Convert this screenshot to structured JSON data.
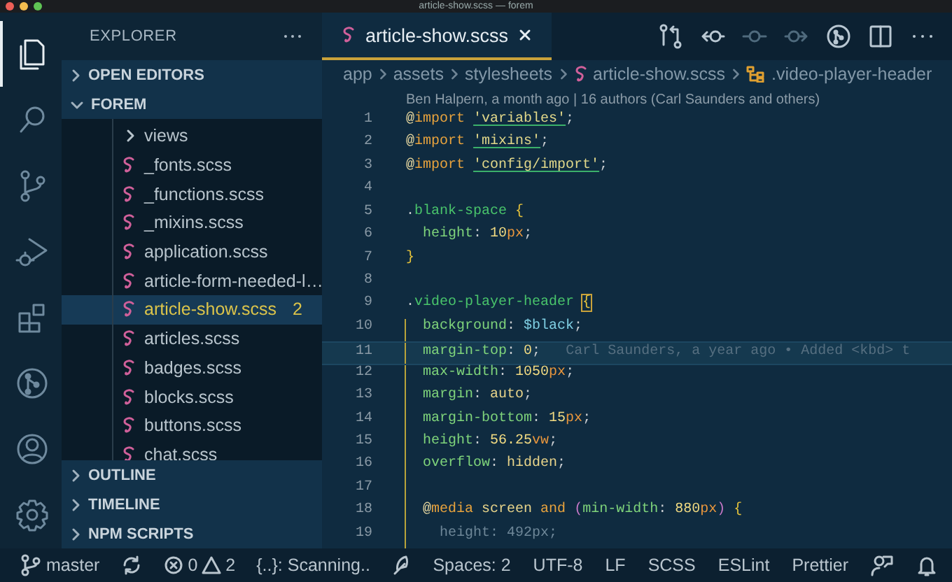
{
  "window": {
    "title": "article-show.scss — forem"
  },
  "activity_bar": [
    {
      "kind": "files",
      "selected": true
    },
    {
      "kind": "search",
      "selected": false
    },
    {
      "kind": "source-control",
      "selected": false
    },
    {
      "kind": "run",
      "selected": false
    },
    {
      "kind": "extensions",
      "selected": false
    },
    {
      "kind": "graph",
      "selected": false
    },
    {
      "kind": "account",
      "selected": false
    },
    {
      "kind": "settings",
      "selected": false
    }
  ],
  "sidebar": {
    "title": "EXPLORER",
    "sections": [
      {
        "label": "OPEN EDITORS",
        "expanded": false
      },
      {
        "label": "FOREM",
        "expanded": true,
        "items": [
          {
            "label": "views",
            "kind": "folder",
            "selected": false
          },
          {
            "label": "_fonts.scss",
            "kind": "scss",
            "selected": false
          },
          {
            "label": "_functions.scss",
            "kind": "scss",
            "selected": false
          },
          {
            "label": "_mixins.scss",
            "kind": "scss",
            "selected": false
          },
          {
            "label": "application.scss",
            "kind": "scss",
            "selected": false
          },
          {
            "label": "article-form-needed-l…",
            "kind": "scss",
            "selected": false
          },
          {
            "label": "article-show.scss",
            "kind": "scss",
            "selected": true,
            "badge": "2"
          },
          {
            "label": "articles.scss",
            "kind": "scss",
            "selected": false
          },
          {
            "label": "badges.scss",
            "kind": "scss",
            "selected": false
          },
          {
            "label": "blocks.scss",
            "kind": "scss",
            "selected": false
          },
          {
            "label": "buttons.scss",
            "kind": "scss",
            "selected": false
          },
          {
            "label": "chat.scss",
            "kind": "scss",
            "selected": false
          }
        ]
      },
      {
        "label": "OUTLINE",
        "expanded": false
      },
      {
        "label": "TIMELINE",
        "expanded": false
      },
      {
        "label": "NPM SCRIPTS",
        "expanded": false
      }
    ]
  },
  "editor": {
    "tabs": [
      {
        "label": "article-show.scss",
        "selected": true
      }
    ],
    "actions": [
      {
        "kind": "compare",
        "disabled": false
      },
      {
        "kind": "prev",
        "disabled": false
      },
      {
        "kind": "dot",
        "disabled": true
      },
      {
        "kind": "next",
        "disabled": true
      },
      {
        "kind": "graph",
        "disabled": false
      },
      {
        "kind": "split",
        "disabled": false
      },
      {
        "kind": "more",
        "disabled": false
      }
    ],
    "breadcrumbs": [
      {
        "label": "app",
        "kind": "folder"
      },
      {
        "label": "assets",
        "kind": "folder"
      },
      {
        "label": "stylesheets",
        "kind": "folder"
      },
      {
        "label": "article-show.scss",
        "kind": "file"
      },
      {
        "label": ".video-player-header",
        "kind": "symbol"
      }
    ],
    "blame_header": "Ben Halpern, a month ago | 16 authors (Carl Saunders and others)",
    "lines": [
      {
        "number": "1",
        "tokens": [
          {
            "text": "@",
            "kind": "at"
          },
          {
            "text": "import ",
            "kind": "kw"
          },
          {
            "text": "'variables'",
            "kind": "str"
          },
          {
            "text": ";",
            "kind": "p"
          }
        ]
      },
      {
        "number": "2",
        "tokens": [
          {
            "text": "@",
            "kind": "at"
          },
          {
            "text": "import ",
            "kind": "kw"
          },
          {
            "text": "'mixins'",
            "kind": "str"
          },
          {
            "text": ";",
            "kind": "p"
          }
        ]
      },
      {
        "number": "3",
        "tokens": [
          {
            "text": "@",
            "kind": "at"
          },
          {
            "text": "import ",
            "kind": "kw"
          },
          {
            "text": "'config/import'",
            "kind": "str"
          },
          {
            "text": ";",
            "kind": "p"
          }
        ]
      },
      {
        "number": "4"
      },
      {
        "number": "5",
        "tokens": [
          {
            "text": ".",
            "kind": "p"
          },
          {
            "text": "blank-space ",
            "kind": "sel"
          },
          {
            "text": "{",
            "kind": "brace"
          }
        ]
      },
      {
        "number": "6",
        "tokens": [
          {
            "text": "  height",
            "kind": "prop"
          },
          {
            "text": ": ",
            "kind": "p"
          },
          {
            "text": "10",
            "kind": "num"
          },
          {
            "text": "px",
            "kind": "unit"
          },
          {
            "text": ";",
            "kind": "p"
          }
        ]
      },
      {
        "number": "7",
        "tokens": [
          {
            "text": "}",
            "kind": "brace"
          }
        ]
      },
      {
        "number": "8"
      },
      {
        "number": "9",
        "tokens": [
          {
            "text": ".",
            "kind": "p"
          },
          {
            "text": "video-player-header ",
            "kind": "sel"
          },
          {
            "text": "{",
            "kind": "match"
          }
        ]
      },
      {
        "number": "10",
        "in_block": true,
        "tokens": [
          {
            "text": "  background",
            "kind": "prop"
          },
          {
            "text": ": ",
            "kind": "p"
          },
          {
            "text": "$black",
            "kind": "var"
          },
          {
            "text": ";",
            "kind": "p"
          }
        ]
      },
      {
        "number": "11",
        "in_block": true,
        "current": true,
        "blame": "Carl Saunders, a year ago • Added <kbd> t",
        "tokens": [
          {
            "text": "  margin-top",
            "kind": "prop"
          },
          {
            "text": ": ",
            "kind": "p"
          },
          {
            "text": "0",
            "kind": "num"
          },
          {
            "text": ";",
            "kind": "p"
          }
        ]
      },
      {
        "number": "12",
        "in_block": true,
        "tokens": [
          {
            "text": "  max-width",
            "kind": "prop"
          },
          {
            "text": ": ",
            "kind": "p"
          },
          {
            "text": "1050",
            "kind": "num"
          },
          {
            "text": "px",
            "kind": "unit"
          },
          {
            "text": ";",
            "kind": "p"
          }
        ]
      },
      {
        "number": "13",
        "in_block": true,
        "tokens": [
          {
            "text": "  margin",
            "kind": "prop"
          },
          {
            "text": ": ",
            "kind": "p"
          },
          {
            "text": "auto",
            "kind": "val"
          },
          {
            "text": ";",
            "kind": "p"
          }
        ]
      },
      {
        "number": "14",
        "in_block": true,
        "tokens": [
          {
            "text": "  margin-bottom",
            "kind": "prop"
          },
          {
            "text": ": ",
            "kind": "p"
          },
          {
            "text": "15",
            "kind": "num"
          },
          {
            "text": "px",
            "kind": "unit"
          },
          {
            "text": ";",
            "kind": "p"
          }
        ]
      },
      {
        "number": "15",
        "in_block": true,
        "tokens": [
          {
            "text": "  height",
            "kind": "prop"
          },
          {
            "text": ": ",
            "kind": "p"
          },
          {
            "text": "56.25",
            "kind": "num"
          },
          {
            "text": "vw",
            "kind": "unit"
          },
          {
            "text": ";",
            "kind": "p"
          }
        ]
      },
      {
        "number": "16",
        "in_block": true,
        "tokens": [
          {
            "text": "  overflow",
            "kind": "prop"
          },
          {
            "text": ": ",
            "kind": "p"
          },
          {
            "text": "hidden",
            "kind": "val"
          },
          {
            "text": ";",
            "kind": "p"
          }
        ]
      },
      {
        "number": "17",
        "in_block": true
      },
      {
        "number": "18",
        "in_block": true,
        "tokens": [
          {
            "text": "  @",
            "kind": "at"
          },
          {
            "text": "media",
            "kind": "kw"
          },
          {
            "text": " screen ",
            "kind": "val"
          },
          {
            "text": "and ",
            "kind": "kw"
          },
          {
            "text": "(",
            "kind": "paren"
          },
          {
            "text": "min-width",
            "kind": "prop"
          },
          {
            "text": ": ",
            "kind": "p"
          },
          {
            "text": "880",
            "kind": "num"
          },
          {
            "text": "px",
            "kind": "unit"
          },
          {
            "text": ") ",
            "kind": "paren"
          },
          {
            "text": "{",
            "kind": "brace"
          }
        ]
      },
      {
        "number": "19",
        "in_block": true,
        "tokens": [
          {
            "text": "    height: 492px;",
            "kind": "dim"
          }
        ]
      }
    ]
  },
  "status_bar": {
    "left": [
      {
        "kind": "branch",
        "label": "master"
      },
      {
        "kind": "sync"
      },
      {
        "kind": "problems",
        "errors": "0",
        "warnings": "2"
      },
      {
        "kind": "text",
        "label": "{..}: Scanning.."
      },
      {
        "kind": "feather"
      }
    ],
    "right": [
      {
        "kind": "text",
        "label": "Spaces: 2"
      },
      {
        "kind": "text",
        "label": "UTF-8"
      },
      {
        "kind": "text",
        "label": "LF"
      },
      {
        "kind": "text",
        "label": "SCSS"
      },
      {
        "kind": "text",
        "label": "ESLint"
      },
      {
        "kind": "text",
        "label": "Prettier"
      },
      {
        "kind": "feedback"
      },
      {
        "kind": "bell"
      }
    ]
  }
}
